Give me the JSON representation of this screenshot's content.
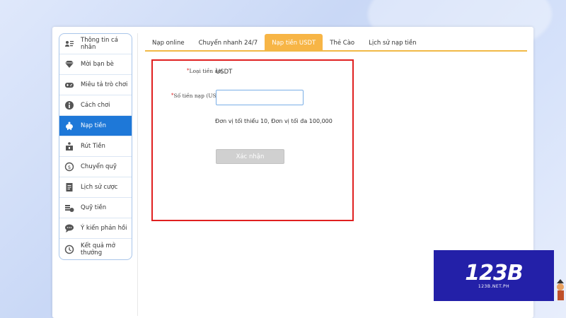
{
  "sidebar": {
    "items": [
      {
        "label": "Thông tin cá nhân",
        "icon": "profile-card-icon",
        "active": false
      },
      {
        "label": "Mời bạn bè",
        "icon": "diamond-icon",
        "active": false
      },
      {
        "label": "Miêu tả trò chơi",
        "icon": "gamepad-icon",
        "active": false
      },
      {
        "label": "Cách chơi",
        "icon": "info-icon",
        "active": false
      },
      {
        "label": "Nạp tiền",
        "icon": "piggy-bank-icon",
        "active": true
      },
      {
        "label": "Rút Tiền",
        "icon": "withdraw-icon",
        "active": false
      },
      {
        "label": "Chuyển quỹ",
        "icon": "transfer-icon",
        "active": false
      },
      {
        "label": "Lịch sử cược",
        "icon": "history-doc-icon",
        "active": false
      },
      {
        "label": "Quỹ tiền",
        "icon": "coins-icon",
        "active": false
      },
      {
        "label": "Ý kiến phản hồi",
        "icon": "feedback-icon",
        "active": false
      },
      {
        "label": "Kết quả mở thưởng",
        "icon": "result-history-icon",
        "active": false
      }
    ]
  },
  "tabs": [
    {
      "label": "Nạp online",
      "active": false
    },
    {
      "label": "Chuyển nhanh 24/7",
      "active": false
    },
    {
      "label": "Nạp tiền USDT",
      "active": true
    },
    {
      "label": "Thẻ Cào",
      "active": false
    },
    {
      "label": "Lịch sử nạp tiền",
      "active": false
    }
  ],
  "form": {
    "currency_label": "Loại tiền ảo:",
    "currency_value": "USDT",
    "amount_label": "Số tiền nạp (USDT):",
    "amount_value": "",
    "required_mark": "*",
    "hint": "Đơn vị tối thiểu 10, Đơn vị tối đa 100,000",
    "confirm_label": "Xác nhận"
  },
  "brand": {
    "logo_text": "123B",
    "logo_subtext": "123B.NET.PH"
  },
  "colors": {
    "active_sidebar": "#1e78d8",
    "active_tab": "#f7b546",
    "highlight_border": "#e02020",
    "logo_bg": "#2320a8"
  }
}
